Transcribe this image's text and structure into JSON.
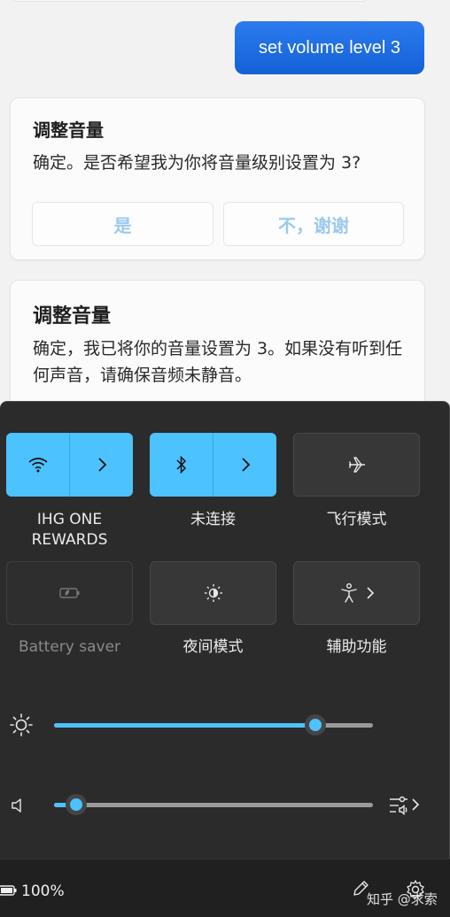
{
  "chat": {
    "user_message": "set volume level 3",
    "card1": {
      "title": "调整音量",
      "body": "确定。是否希望我为你将音量级别设置为 3?",
      "yes_label": "是",
      "no_label": "不，谢谢"
    },
    "card2": {
      "title": "调整音量",
      "body": "确定，我已将你的音量设置为 3。如果没有听到任何声音，请确保音频未静音。"
    }
  },
  "quick_settings": {
    "tiles": {
      "wifi": {
        "label": "IHG ONE REWARDS",
        "active": true,
        "icon": "wifi-icon"
      },
      "bluetooth": {
        "label": "未连接",
        "active": true,
        "icon": "bluetooth-icon"
      },
      "airplane": {
        "label": "飞行模式",
        "active": false,
        "icon": "airplane-icon"
      },
      "battery_saver": {
        "label": "Battery saver",
        "active": false,
        "disabled": true,
        "icon": "battery-saver-icon"
      },
      "night_light": {
        "label": "夜间模式",
        "active": false,
        "icon": "night-light-icon"
      },
      "accessibility": {
        "label": "辅助功能",
        "active": false,
        "icon": "accessibility-icon"
      }
    },
    "brightness": {
      "value_fraction": 0.82,
      "icon": "sun-icon"
    },
    "volume": {
      "value_fraction": 0.07,
      "icon": "speaker-icon"
    },
    "footer": {
      "battery_percent": "100%",
      "watermark": "知乎 @求索"
    }
  },
  "colors": {
    "accent": "#4cc2ff",
    "user_bubble": "#1f6fe3",
    "panel_bg": "#2b2b2b",
    "choice_text": "#9cc9ee"
  }
}
